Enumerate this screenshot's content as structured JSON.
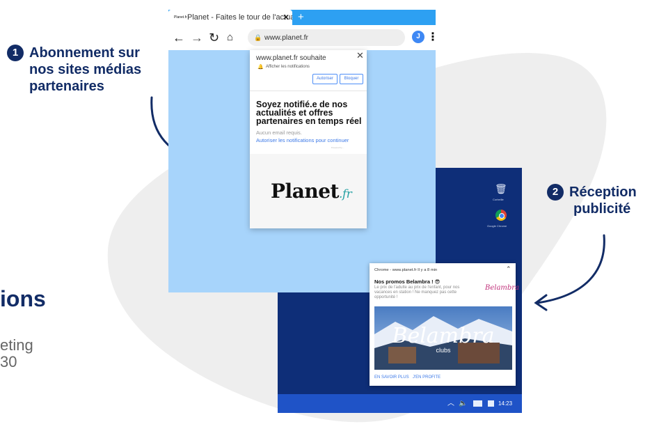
{
  "step1": {
    "number": "1",
    "lines": [
      "Abonnement sur",
      "nos sites médias",
      "partenaires"
    ]
  },
  "step2": {
    "number": "2",
    "lines": [
      "Réception",
      "publicité"
    ]
  },
  "left_partial": {
    "heading": "ions",
    "sub_line1": "eting",
    "sub_line2": "30"
  },
  "browser": {
    "tab_favicon": "Planet.fr",
    "tab_title": "Planet - Faites le tour de l'actualit...",
    "tab_close": "✕",
    "new_tab": "+",
    "url": "www.planet.fr",
    "avatar_initial": "J",
    "icons": [
      "back-arrow-icon",
      "forward-arrow-icon",
      "reload-icon",
      "home-icon",
      "lock-icon",
      "menu-dots-icon"
    ]
  },
  "permission_popup": {
    "site": "www.planet.fr souhaite",
    "close": "✕",
    "label": "Afficher les notifications",
    "allow": "Autoriser",
    "block": "Bloquer"
  },
  "page_card": {
    "title": "Soyez notifié.e de nos actualités et offres partenaires en temps réel",
    "subtitle": "Aucun email requis.",
    "link": "Autoriser les notifications pour continuer",
    "tiny": "Powered by ...",
    "logo": "Planet",
    "logo_suffix": ".fr"
  },
  "desktop": {
    "trash_label": "Corbeille",
    "chrome_label": "Google Chrome",
    "time": "14:23",
    "colors": {
      "desktop_bg": "#0e2e78",
      "taskbar": "#1f53c7"
    }
  },
  "toast": {
    "header": "Chrome - www.planet.fr   Il y a 8 min",
    "title": "Nos promos Belambra ! 😎",
    "body": "Le prix de l'adulte au prix de l'enfant, pour nos vacances en station ! Ne manquez pas cette opportunité !",
    "logo": "Belambra",
    "image_text": "Belambra",
    "image_subtext": "clubs",
    "action1": "EN SAVOIR PLUS",
    "action2": "J'EN PROFITE"
  },
  "colors": {
    "navy": "#122c66",
    "browser_blue": "#a7d4fb",
    "tab_blue": "#2da0f2",
    "blob": "#eeeeee"
  }
}
